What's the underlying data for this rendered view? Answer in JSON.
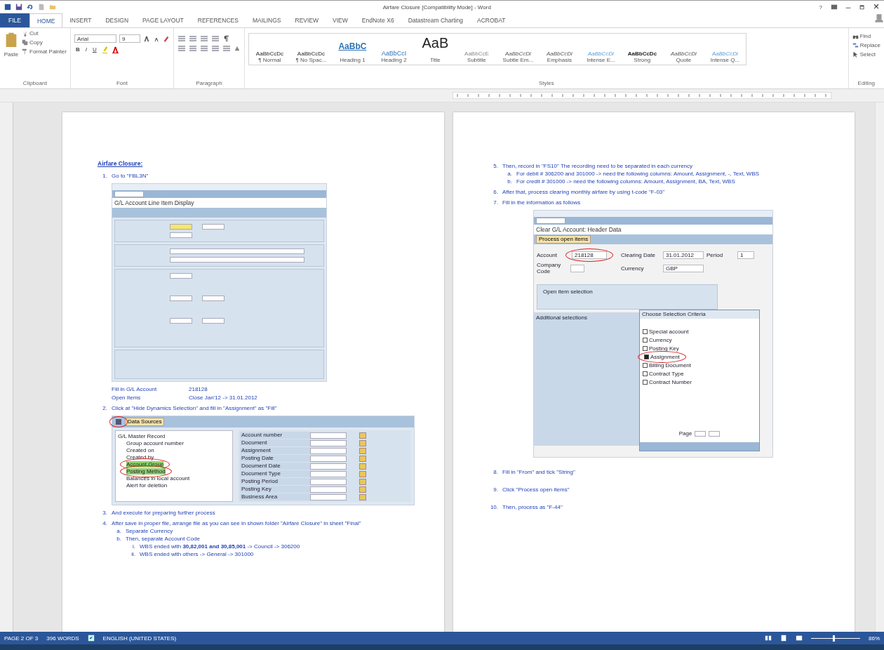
{
  "window": {
    "title": "Airfare Closure [Compatibility Mode] - Word",
    "help": "?"
  },
  "tabs": [
    {
      "label": "FILE",
      "kind": "file",
      "selected": false
    },
    {
      "label": "HOME",
      "kind": "tab",
      "selected": true
    },
    {
      "label": "INSERT",
      "kind": "tab",
      "selected": false
    },
    {
      "label": "DESIGN",
      "kind": "tab",
      "selected": false
    },
    {
      "label": "PAGE LAYOUT",
      "kind": "tab",
      "selected": false
    },
    {
      "label": "REFERENCES",
      "kind": "tab",
      "selected": false
    },
    {
      "label": "MAILINGS",
      "kind": "tab",
      "selected": false
    },
    {
      "label": "REVIEW",
      "kind": "tab",
      "selected": false
    },
    {
      "label": "VIEW",
      "kind": "tab",
      "selected": false
    },
    {
      "label": "EndNote X6",
      "kind": "tab",
      "selected": false
    },
    {
      "label": "Datastream Charting",
      "kind": "tab",
      "selected": false
    },
    {
      "label": "ACROBAT",
      "kind": "tab",
      "selected": false
    }
  ],
  "ribbon": {
    "clipboard": {
      "paste": "Paste",
      "cut": "Cut",
      "copy": "Copy",
      "format_painter": "Format Painter",
      "label": "Clipboard"
    },
    "font": {
      "name": "Arial",
      "size": "9",
      "format_buttons": [
        "B",
        "I",
        "U"
      ],
      "label": "Font"
    },
    "paragraph": {
      "label": "Paragraph"
    },
    "styles": {
      "label": "Styles",
      "items": [
        {
          "preview": "AaBbCcDc",
          "name": "¶ Normal",
          "kind": "plain"
        },
        {
          "preview": "AaBbCcDc",
          "name": "¶ No Spac...",
          "kind": "plain"
        },
        {
          "preview": "AaBbC",
          "name": "Heading 1",
          "kind": "heading"
        },
        {
          "preview": "AaBbCcI",
          "name": "Heading 2",
          "kind": "heading2"
        },
        {
          "preview": "AaB",
          "name": "Title",
          "kind": "title"
        },
        {
          "preview": "AaBbCcE",
          "name": "Subtitle",
          "kind": "faint"
        },
        {
          "preview": "AaBbCcDi",
          "name": "Subtle Em...",
          "kind": "italic"
        },
        {
          "preview": "AaBbCcDi",
          "name": "Emphasis",
          "kind": "italic"
        },
        {
          "preview": "AaBbCcDi",
          "name": "Intense E...",
          "kind": "intense"
        },
        {
          "preview": "AaBbCcDc",
          "name": "Strong",
          "kind": "strong"
        },
        {
          "preview": "AaBbCcDi",
          "name": "Quote",
          "kind": "italic"
        },
        {
          "preview": "AaBbCcDi",
          "name": "Intense Q...",
          "kind": "intense"
        }
      ]
    },
    "editing": {
      "label": "Editing",
      "find": "Find",
      "replace": "Replace",
      "select": "Select"
    }
  },
  "pages": [
    {
      "blocks": [
        {
          "kind": "heading",
          "text": "Airfare Closure:"
        },
        {
          "kind": "item",
          "number": "1.",
          "text": "Go to \"FBL3N\""
        },
        {
          "kind": "sap-line-items",
          "title": "G/L Account Line Item Display"
        },
        {
          "kind": "pairs",
          "rows": [
            {
              "label": "Fill in G/L Account",
              "value": "218128"
            },
            {
              "label": "Open Items",
              "value": "Close Jan'12 -> 31.01.2012"
            }
          ]
        },
        {
          "kind": "item",
          "number": "2.",
          "text": "Click at \"Hide Dynamics Selection\" and fill in \"Assignment\" as \"Fill\""
        },
        {
          "kind": "sap-dynamic",
          "button": "Data Sources",
          "tree_root": "G/L Master Record",
          "tree": [
            {
              "label": "Group account number",
              "circled": false
            },
            {
              "label": "Created on",
              "circled": false
            },
            {
              "label": "Created by",
              "circled": false
            },
            {
              "label": "Account Group",
              "circled": true
            },
            {
              "label": "Posting Method",
              "circled": true
            },
            {
              "label": "Balances in local account",
              "circled": false
            },
            {
              "label": "Alert for deletion",
              "circled": false
            }
          ],
          "fields": [
            "Account number",
            "Document",
            "Assignment",
            "Posting Date",
            "Document Date",
            "Document Type",
            "Posting Period",
            "Posting Key",
            "Business Area"
          ]
        },
        {
          "kind": "item",
          "number": "3.",
          "text": "And execute for preparing further process"
        },
        {
          "kind": "item",
          "number": "4.",
          "text": "After save in proper file, arrange file as you can see in shown folder \"Airfare Closure\" in sheet \"Final\"",
          "children": [
            {
              "number": "a.",
              "text": "Separate Currency"
            },
            {
              "number": "b.",
              "text": "Then, separate Account Code",
              "children": [
                {
                  "number": "i.",
                  "text": "WBS ended with **30,82,001 and 30,85,001** -> Council -> 306200"
                },
                {
                  "number": "ii.",
                  "text": "WBS ended with others -> General -> 301000"
                }
              ]
            }
          ]
        }
      ]
    },
    {
      "blocks": [
        {
          "kind": "item",
          "number": "5.",
          "text": "Then, record in \"FS10\" The recording need to be separated in each currency",
          "children": [
            {
              "number": "a.",
              "text": "For debit # 306200 and 301000       -> need the following columns: Amount, Assignment, -, Text, WBS"
            },
            {
              "number": "b.",
              "text": "For credit # 301000                          -> need the following columns: Amount, Assignment, BA, Text, WBS"
            }
          ]
        },
        {
          "kind": "item",
          "number": "6.",
          "text": "After that, process clearing monthly airfare by using t-code \"F-03\""
        },
        {
          "kind": "item",
          "number": "7.",
          "text": "Fill in the information as follows"
        },
        {
          "kind": "sap-clear",
          "title": "Clear G/L Account: Header Data",
          "button": "Process open items",
          "account_label": "Account",
          "account_value": "218128",
          "company_label": "Company Code",
          "clearing_label": "Clearing Date",
          "clearing_value": "31.01.2012",
          "period_label": "Period",
          "period_value": "1",
          "currency_label": "Currency",
          "currency_value": "GBP",
          "panel1": "Open item selection",
          "panel2": "Additional selections",
          "popup_title": "Choose Selection Criteria",
          "page_label": "Page",
          "options": [
            {
              "label": "Special account",
              "checked": false
            },
            {
              "label": "Currency",
              "checked": false
            },
            {
              "label": "Posting Key",
              "checked": false
            },
            {
              "label": "Assignment",
              "checked": true
            },
            {
              "label": "Billing Document",
              "checked": false
            },
            {
              "label": "Contract Type",
              "checked": false
            },
            {
              "label": "Contract Number",
              "checked": false
            }
          ]
        },
        {
          "kind": "item",
          "number": "8.",
          "text": "Fill in \"From\" and tick \"String\""
        },
        {
          "kind": "item",
          "number": "9.",
          "text": "Click \"Process open items\""
        },
        {
          "kind": "item",
          "number": "10.",
          "text": "Then, process as \"F-44\""
        }
      ]
    }
  ],
  "status_bar": {
    "page": "PAGE 2 OF 3",
    "words": "396 WORDS",
    "language": "ENGLISH (UNITED STATES)",
    "zoom": "86%",
    "level": 0.45
  }
}
